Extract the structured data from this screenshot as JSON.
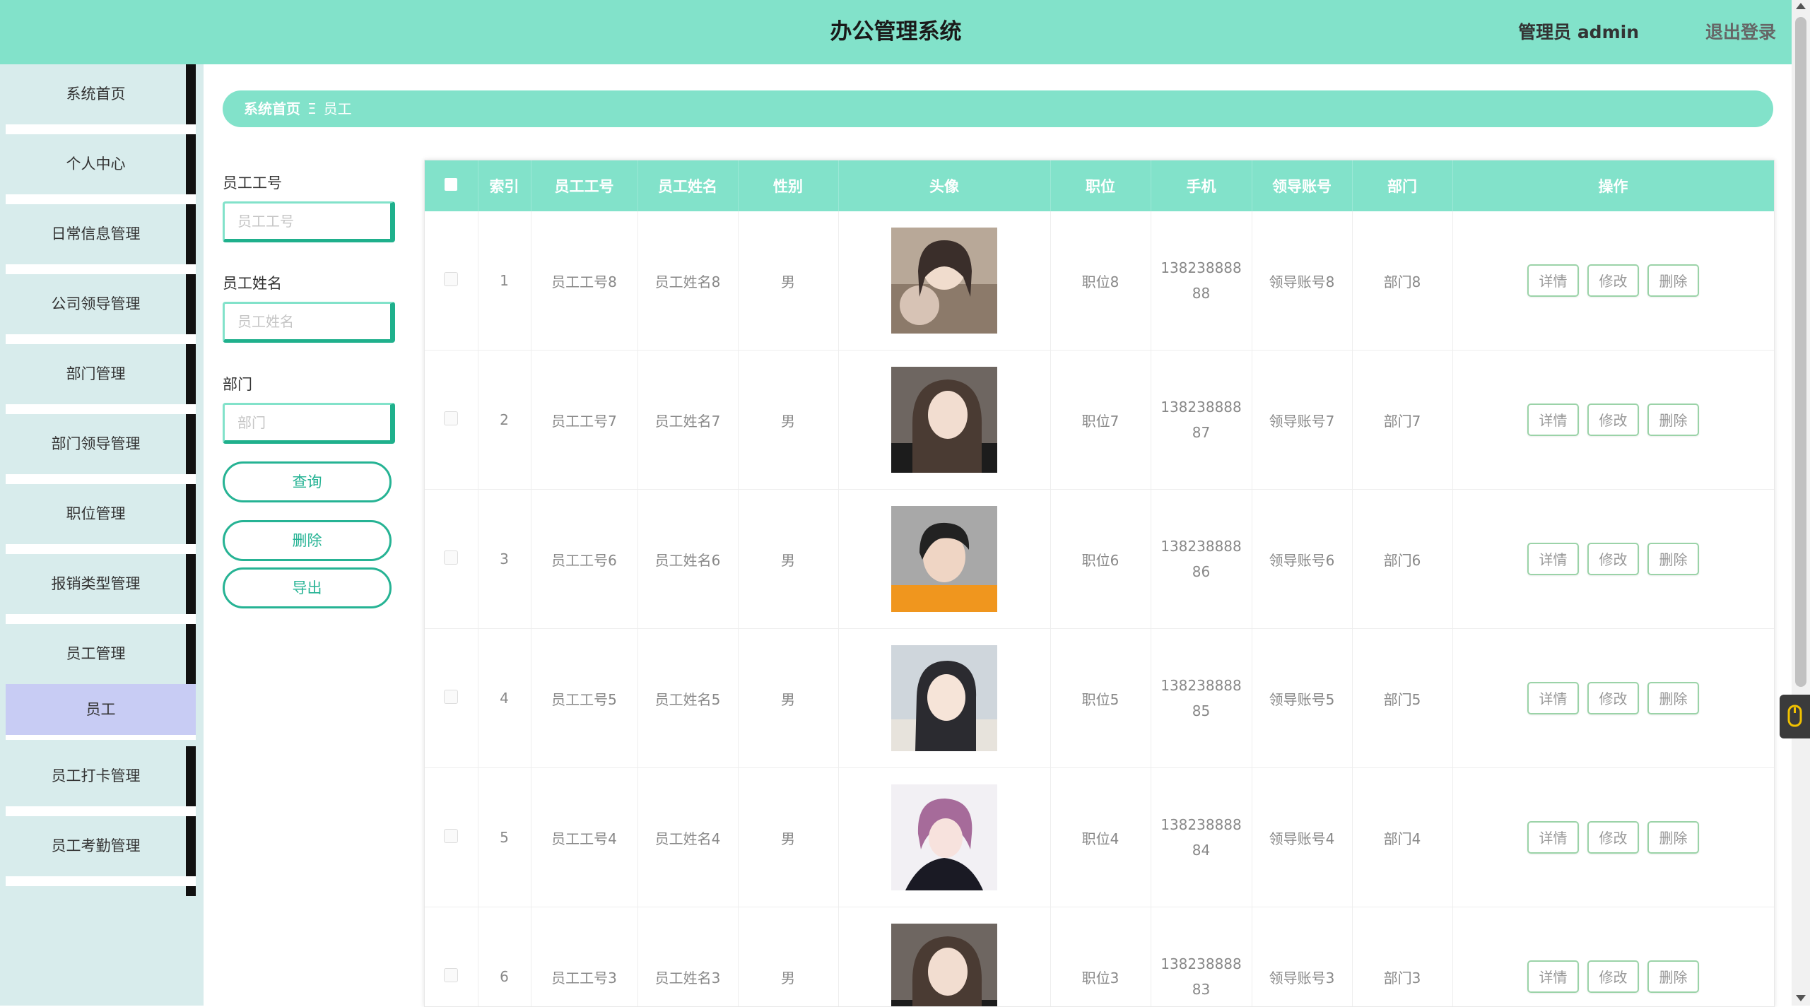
{
  "header": {
    "title": "办公管理系统",
    "user": "管理员 admin",
    "logout": "退出登录"
  },
  "sidebar": {
    "items": [
      "系统首页",
      "个人中心",
      "日常信息管理",
      "公司领导管理",
      "部门管理",
      "部门领导管理",
      "职位管理",
      "报销类型管理",
      "员工管理"
    ],
    "sub_item": "员工",
    "items_after": [
      "员工打卡管理",
      "员工考勤管理"
    ]
  },
  "breadcrumb": {
    "home": "系统首页",
    "separator": "Ξ",
    "current": "员工"
  },
  "search": {
    "emp_no_label": "员工工号",
    "emp_no_placeholder": "员工工号",
    "emp_name_label": "员工姓名",
    "emp_name_placeholder": "员工姓名",
    "dept_label": "部门",
    "dept_placeholder": "部门",
    "query_btn": "查询",
    "delete_btn": "删除",
    "export_btn": "导出"
  },
  "table": {
    "headers": [
      "索引",
      "员工工号",
      "员工姓名",
      "性别",
      "头像",
      "职位",
      "手机",
      "领导账号",
      "部门",
      "操作"
    ],
    "actions": {
      "detail": "详情",
      "edit": "修改",
      "delete": "删除"
    },
    "rows": [
      {
        "index": "1",
        "no": "员工工号8",
        "name": "员工姓名8",
        "gender": "男",
        "position": "职位8",
        "phone1": "138238888",
        "phone2": "88",
        "leader": "领导账号8",
        "dept": "部门8"
      },
      {
        "index": "2",
        "no": "员工工号7",
        "name": "员工姓名7",
        "gender": "男",
        "position": "职位7",
        "phone1": "138238888",
        "phone2": "87",
        "leader": "领导账号7",
        "dept": "部门7"
      },
      {
        "index": "3",
        "no": "员工工号6",
        "name": "员工姓名6",
        "gender": "男",
        "position": "职位6",
        "phone1": "138238888",
        "phone2": "86",
        "leader": "领导账号6",
        "dept": "部门6"
      },
      {
        "index": "4",
        "no": "员工工号5",
        "name": "员工姓名5",
        "gender": "男",
        "position": "职位5",
        "phone1": "138238888",
        "phone2": "85",
        "leader": "领导账号5",
        "dept": "部门5"
      },
      {
        "index": "5",
        "no": "员工工号4",
        "name": "员工姓名4",
        "gender": "男",
        "position": "职位4",
        "phone1": "138238888",
        "phone2": "84",
        "leader": "领导账号4",
        "dept": "部门4"
      },
      {
        "index": "6",
        "no": "员工工号3",
        "name": "员工姓名3",
        "gender": "男",
        "position": "职位3",
        "phone1": "138238888",
        "phone2": "83",
        "leader": "领导账号3",
        "dept": "部门3"
      }
    ]
  },
  "colors": {
    "accent": "#82e2ca",
    "accent_dark": "#26b394",
    "sidebar_bg": "#d8ecec",
    "active_sub": "#c8ccf4"
  }
}
